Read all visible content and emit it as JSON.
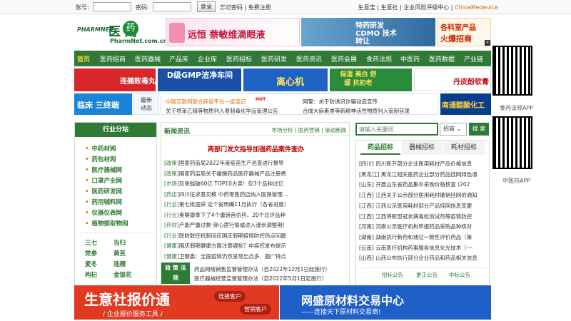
{
  "topbar": {
    "account_label": "账号:",
    "password_label": "密码:",
    "login_label": "登录",
    "forgot_label": "忘记密码",
    "sep": "|",
    "register_label": "免费注册",
    "right_links": [
      "生意宝",
      "生意社",
      "企业风险评级中心"
    ],
    "china_medevice": "ChinaMedevice"
  },
  "logo": {
    "en": "PHARMNET",
    "cn": "医 网",
    "circle": "药",
    "url": "PharmNet.com.cn"
  },
  "top_banners": {
    "b1_text": "远恒  萘敏维滴眼液",
    "b2_text": "特药研发 CDMO 技术转让",
    "b3_line1": "各科室产品",
    "b3_line2": "火爆招商"
  },
  "nav": [
    "首页",
    "医药招商",
    "医药器械",
    "产品库",
    "企业库",
    "医药招标",
    "医药研发",
    "医药资讯",
    "医药会展",
    "食药法规",
    "中医药",
    "医药数据",
    "产业链"
  ],
  "ads_row1": [
    "连翘败毒丸",
    "D级GMP洁净车间",
    "离心机",
    "保湿 美白 舒缓 抗初老",
    "丹皮酚软膏"
  ],
  "ads_row2": {
    "a1": "临床  三终端",
    "a2_line1": "最新",
    "a2_line2": "动态",
    "a3": "南通醋酸化工"
  },
  "ticker": [
    "中国互联网联合辟谣平台—捉谣记",
    "网警：关于防诱讯诈骗动造宣传",
    "关于将苯乙腈等物质列入易制毒化学品管理公告",
    "合成大麻素类等新精神活性物质列入管制目录"
  ],
  "ticker_hot": "HOT",
  "qr_labels": [
    "食药法规APP",
    "中医药APP"
  ],
  "sidebar": {
    "title": "行业分站",
    "items": [
      "中药材网",
      "药包材网",
      "医疗器械网",
      "口罩产业网",
      "医药研发网",
      "药用辅料网",
      "仪器仪表网",
      "植物提取物网"
    ],
    "herbs": [
      [
        "三七",
        "当归"
      ],
      [
        "党参",
        "黄芪"
      ],
      [
        "麦冬",
        "连翘"
      ],
      [
        "枸杞",
        "金银花"
      ]
    ]
  },
  "news": {
    "title": "新闻资讯",
    "more": "市场分析 | 医药营销 | 滚动新闻",
    "headline": "两部门发文指导加强药品案件查办",
    "rows": [
      [
        "[政策]",
        "国家药监局2022年度疫苗生产巡查进行督导"
      ],
      [
        "[政策]",
        "国家药监局关于缓缴药品医疗器械产品注册费"
      ],
      [
        "[市场]",
        "玩骨能破60亿 TOP10大卖！仅3个品种过亿"
      ],
      [
        "[药店]",
        "四川征求意见稿 中药零售药店纳入医保管理…"
      ],
      [
        "[行业]",
        "第七批国采 这个省明确11月执行（各省进度）"
      ],
      [
        "[行业]",
        "奥赛康拿下了4个重磅首仿药、20个过评品种"
      ],
      [
        "[药材]",
        "产能严重过剩 穿心莲行情或进入漫长调整期!"
      ],
      [
        "[行业]",
        "联防联控机制回应国庆假期疫情防控热点问题"
      ],
      [
        "[健康]",
        "国庆假期健康方面注意哪些？中疾控发布提示"
      ],
      [
        "[健康]",
        "卫健委：全国疫情仍然呈现出点多、面广特点"
      ]
    ],
    "policy_label": "政 策 法 规",
    "policy_rows": [
      "药品网络销售监督管理办法（自2022年12月1日起施行）",
      "医疗器械经营监督管理办法（自2022年5月1日起施行）"
    ]
  },
  "search": {
    "placeholder": "请输入关键词",
    "select": "招商",
    "button": "搜 索"
  },
  "tender": {
    "tabs": [
      "药品招标",
      "器械招标",
      "耗材招标"
    ],
    "rows": [
      "[四川] 四川新开部分企业医用耗材产品价格信息",
      "[黑龙江] 黑龙江相关医药企业部分药品挂网绿色通",
      "[山东] 开展山东省药品集中采购价格核查 (202",
      "[江西] 江西关于公示部分医用耗材撤销挂网的通知",
      "[江西] 江西公示医用耗材部分产品挂网信息变更",
      "[江西] 江西将新型冠状病毒检测试剂等疫情防控",
      "[河南] 河南公示医疗机构申报药品采购品种核对",
      "[湖南] 湖南执行新药和通过一致性评价药品（第",
      "[云南] 云南医疗机构药事服务信息化光技术（一",
      "[山西] 山西公布执行部分企业药品和药品相关信息"
    ],
    "footer": [
      "招标公告",
      "更正公告",
      "中标公告"
    ]
  },
  "bottom": {
    "b1_title": "生意社报价通",
    "b1_sub": "/ 企业报价服务工具 /",
    "b1_pill1": "连接客户",
    "b1_pill2": "营销客户",
    "b2_title": "网盛原材料交易中心",
    "b2_sub": "——连接天下原材料交易商!"
  },
  "colors": {
    "brand_green": "#2f7a35",
    "nav_active": "#ffd33a",
    "headline_red": "#bb0000"
  }
}
